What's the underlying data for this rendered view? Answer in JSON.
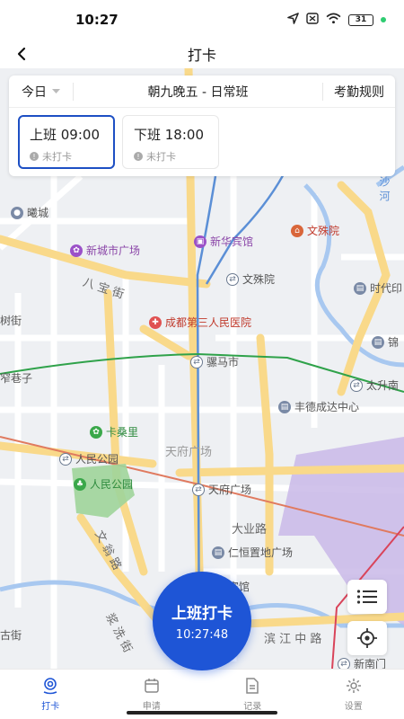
{
  "status": {
    "time": "10:27",
    "battery": "31"
  },
  "header": {
    "title": "打卡"
  },
  "card": {
    "today": "今日",
    "shift_name": "朝九晚五 - 日常班",
    "rules": "考勤规则",
    "shifts": [
      {
        "label": "上班 09:00",
        "status": "未打卡"
      },
      {
        "label": "下班 18:00",
        "status": "未打卡"
      }
    ]
  },
  "map": {
    "labels": {
      "xicheng": "曦城",
      "xinchengshi": "新城市广场",
      "xinhua": "新华宾馆",
      "wenshuyuan1": "文殊院",
      "wenshuyuan2": "文殊院",
      "shiyin": "时代印",
      "babaojie": "八 宝 街",
      "shushujie": "树街",
      "hospital": "成都第三人民医院",
      "jin": "锦",
      "luomashi": "骡马市",
      "zhaixiangzi": "窄巷子",
      "taisheng": "太升南",
      "fengde": "丰德成达中心",
      "kasangli": "卡桑里",
      "tianfu1": "天府广场",
      "renmin1": "人民公园",
      "renmin2": "人民公园",
      "tianfu2": "天府广场",
      "dayelu": "大业路",
      "wenwenglu": "文 翁 路",
      "renheng": "仁恒置地广场",
      "binguan": "宾馆",
      "jianghuai": "浆 洗 街",
      "gujie": "古街",
      "binjiang": "滨 江 中 路",
      "xinnan": "新南门",
      "shahe": "沙 河"
    }
  },
  "clock": {
    "title": "上班打卡",
    "time": "10:27:48"
  },
  "tabs": [
    {
      "label": "打卡"
    },
    {
      "label": "申请"
    },
    {
      "label": "记录"
    },
    {
      "label": "设置"
    }
  ],
  "colors": {
    "accent": "#1e55d6",
    "road_major": "#f9d98a",
    "water": "#a8c8f0",
    "district": "#c9b8e8"
  }
}
